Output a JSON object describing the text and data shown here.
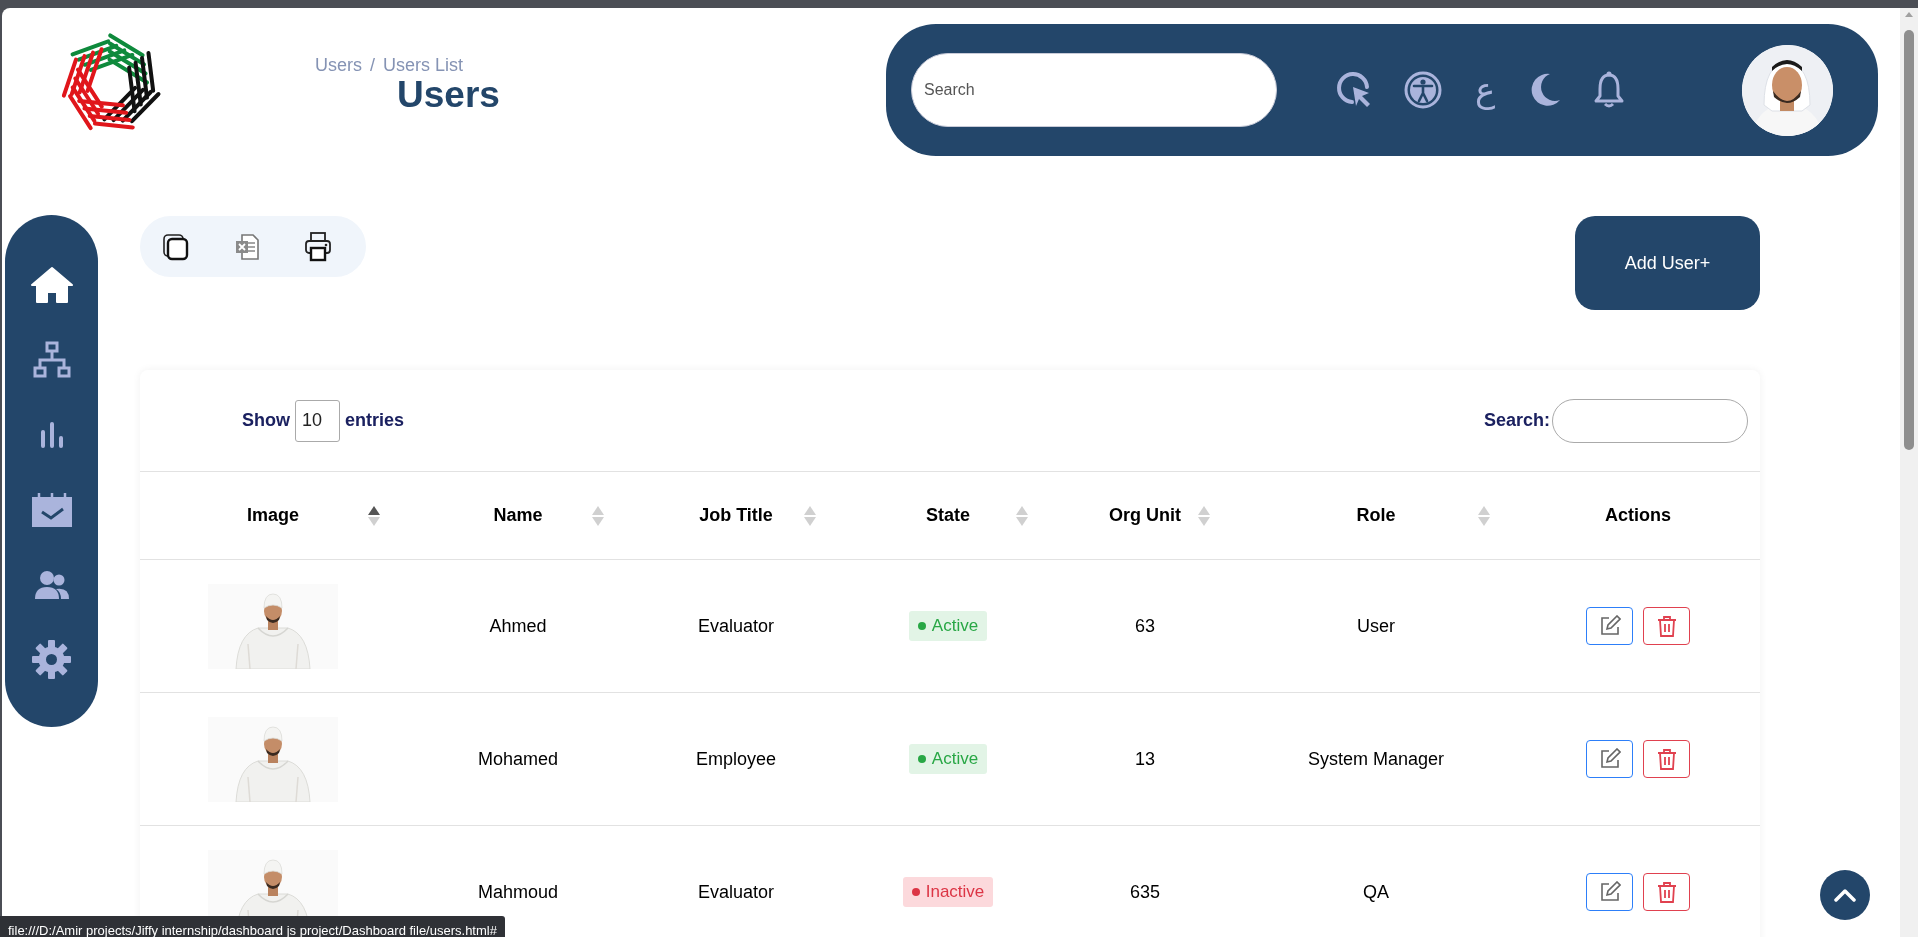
{
  "breadcrumb": {
    "items": [
      "Users",
      "Users List"
    ],
    "separator": "/"
  },
  "page_title": "Users",
  "header": {
    "search": {
      "placeholder": "Search"
    },
    "language_toggle": "ع"
  },
  "sidebar": {
    "items": [
      {
        "selected": true
      },
      {
        "selected": false
      },
      {
        "selected": false
      },
      {
        "selected": false
      },
      {
        "selected": false
      },
      {
        "selected": false
      }
    ]
  },
  "add_button": "Add User+",
  "table": {
    "show_label": "Show",
    "page_length": "10",
    "entries_label": "entries",
    "search_label": "Search:",
    "columns": [
      {
        "label": "Image",
        "sortable": true,
        "sorted": true
      },
      {
        "label": "Name",
        "sortable": true,
        "sorted": false
      },
      {
        "label": "Job Title",
        "sortable": true,
        "sorted": false
      },
      {
        "label": "State",
        "sortable": true,
        "sorted": false
      },
      {
        "label": "Org Unit",
        "sortable": true,
        "sorted": false
      },
      {
        "label": "Role",
        "sortable": true,
        "sorted": false
      },
      {
        "label": "Actions",
        "sortable": false
      }
    ],
    "rows": [
      {
        "name": "Ahmed",
        "job_title": "Evaluator",
        "state": {
          "label": "Active",
          "kind": "active"
        },
        "org_unit": "63",
        "role": "User"
      },
      {
        "name": "Mohamed",
        "job_title": "Employee",
        "state": {
          "label": "Active",
          "kind": "active"
        },
        "org_unit": "13",
        "role": "System Manager"
      },
      {
        "name": "Mahmoud",
        "job_title": "Evaluator",
        "state": {
          "label": "Inactive",
          "kind": "inactive"
        },
        "org_unit": "635",
        "role": "QA"
      }
    ]
  },
  "status_bar": "file:///D:/Amir projects/Jiffy internship/dashboard js project/Dashboard file/users.html#"
}
